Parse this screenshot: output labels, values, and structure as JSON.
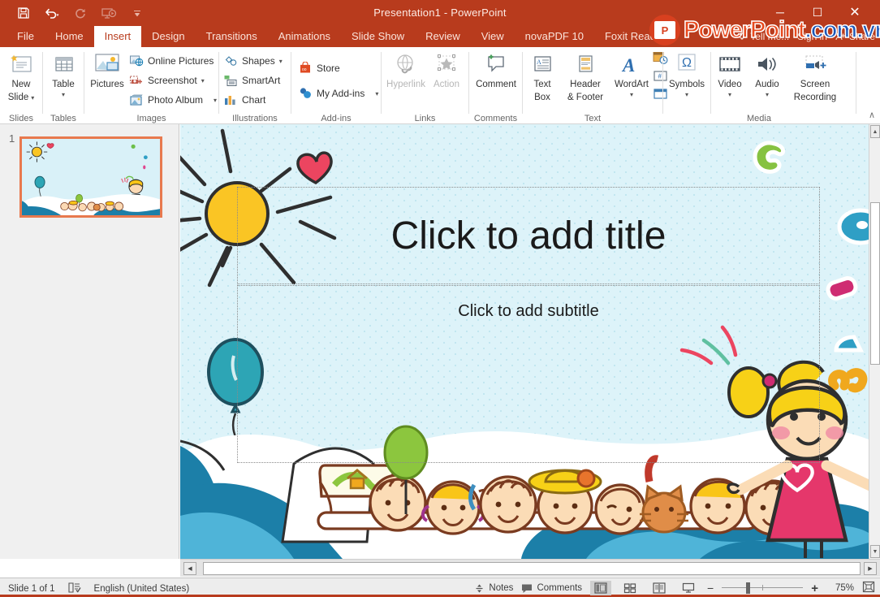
{
  "window": {
    "title": "Presentation1 - PowerPoint",
    "theme_color": "#b83b1d",
    "minimize": "─",
    "maximize": "☐",
    "close": "✕"
  },
  "quick_access": {
    "items": [
      {
        "name": "save-icon",
        "label": "Save"
      },
      {
        "name": "undo-icon",
        "label": "Undo"
      },
      {
        "name": "redo-icon",
        "label": "Redo"
      },
      {
        "name": "start-from-beginning-icon",
        "label": "Start From Beginning"
      },
      {
        "name": "customize-quick-access-toolbar-icon",
        "label": "Customize Quick Access Toolbar"
      }
    ]
  },
  "tabs": [
    {
      "label": "File",
      "active": false
    },
    {
      "label": "Home",
      "active": false
    },
    {
      "label": "Insert",
      "active": true
    },
    {
      "label": "Design",
      "active": false
    },
    {
      "label": "Transitions",
      "active": false
    },
    {
      "label": "Animations",
      "active": false
    },
    {
      "label": "Slide Show",
      "active": false
    },
    {
      "label": "Review",
      "active": false
    },
    {
      "label": "View",
      "active": false
    },
    {
      "label": "novaPDF 10",
      "active": false
    },
    {
      "label": "Foxit Reader",
      "active": false
    }
  ],
  "tab_right": {
    "tell_me": "Tell me...",
    "sign_in": "Sign in",
    "share": "Share"
  },
  "watermark": {
    "badge": "P",
    "part1": "PowerPoint",
    "part2": ".com",
    "part3": ".vn",
    "color1": "#e8491d",
    "color2": "#1b57b8"
  },
  "ribbon": {
    "collapse_label": "∧",
    "groups": [
      {
        "name": "slides",
        "label": "Slides",
        "buttons": [
          {
            "name": "new-slide-button",
            "line1": "New",
            "line2": "Slide",
            "dropdown": true
          }
        ]
      },
      {
        "name": "tables",
        "label": "Tables",
        "buttons": [
          {
            "name": "table-button",
            "line1": "Table",
            "line2": "",
            "dropdown": true
          }
        ]
      },
      {
        "name": "images",
        "label": "Images",
        "buttons": [
          {
            "name": "pictures-button",
            "line1": "Pictures",
            "line2": "",
            "dropdown": false
          }
        ],
        "small_buttons": [
          {
            "name": "online-pictures-button",
            "label": "Online Pictures",
            "dropdown": false
          },
          {
            "name": "screenshot-button",
            "label": "Screenshot",
            "dropdown": true
          },
          {
            "name": "photo-album-button",
            "label": "Photo Album",
            "dropdown": true
          }
        ]
      },
      {
        "name": "illustrations",
        "label": "Illustrations",
        "small_buttons": [
          {
            "name": "shapes-button",
            "label": "Shapes",
            "dropdown": true
          },
          {
            "name": "smartart-button",
            "label": "SmartArt",
            "dropdown": false
          },
          {
            "name": "chart-button",
            "label": "Chart",
            "dropdown": false
          }
        ]
      },
      {
        "name": "add-ins",
        "label": "Add-ins",
        "small_buttons": [
          {
            "name": "store-button",
            "label": "Store",
            "dropdown": false
          },
          {
            "name": "my-add-ins-button",
            "label": "My Add-ins",
            "dropdown": true
          }
        ]
      },
      {
        "name": "links",
        "label": "Links",
        "buttons": [
          {
            "name": "hyperlink-button",
            "line1": "Hyperlink",
            "line2": "",
            "dropdown": false,
            "disabled": true
          },
          {
            "name": "action-button",
            "line1": "Action",
            "line2": "",
            "dropdown": false,
            "disabled": true
          }
        ]
      },
      {
        "name": "comments",
        "label": "Comments",
        "buttons": [
          {
            "name": "comment-button",
            "line1": "Comment",
            "line2": "",
            "dropdown": false
          }
        ]
      },
      {
        "name": "text",
        "label": "Text",
        "buttons": [
          {
            "name": "text-box-button",
            "line1": "Text",
            "line2": "Box",
            "dropdown": false
          },
          {
            "name": "header-and-footer-button",
            "line1": "Header",
            "line2": "& Footer",
            "dropdown": false
          },
          {
            "name": "wordart-button",
            "line1": "WordArt",
            "line2": "",
            "dropdown": true
          }
        ],
        "mini_buttons": [
          {
            "name": "date-and-time-button",
            "label": "Date & Time"
          },
          {
            "name": "slide-number-button",
            "label": "Slide Number"
          },
          {
            "name": "object-button",
            "label": "Object"
          }
        ]
      },
      {
        "name": "symbols",
        "label": "",
        "buttons": [
          {
            "name": "symbols-button",
            "line1": "Symbols",
            "line2": "",
            "dropdown": true,
            "glyph": "Ω"
          }
        ]
      },
      {
        "name": "media",
        "label": "Media",
        "buttons": [
          {
            "name": "video-button",
            "line1": "Video",
            "line2": "",
            "dropdown": true
          },
          {
            "name": "audio-button",
            "line1": "Audio",
            "line2": "",
            "dropdown": true
          },
          {
            "name": "screen-recording-button",
            "line1": "Screen",
            "line2": "Recording",
            "dropdown": false
          }
        ]
      }
    ]
  },
  "thumbnails": [
    {
      "number": "1",
      "selected": true
    }
  ],
  "slide": {
    "title_placeholder": "Click to add title",
    "subtitle_placeholder": "Click to add subtitle",
    "background_color": "#d9f1f8",
    "accent_colors": {
      "sun": "#fac524",
      "balloon_teal": "#2da5b5",
      "balloon_green": "#8cc63e",
      "heart_pink": "#ec4560",
      "wave_blue": "#1c7fa8",
      "dress_pink": "#e5376b",
      "hair_yellow": "#f9c518"
    }
  },
  "status_bar": {
    "slide_count": "Slide 1 of 1",
    "spellcheck_icon": "proofing-icon",
    "language": "English (United States)",
    "notes": "Notes",
    "comments": "Comments",
    "views": [
      {
        "name": "normal-view-button",
        "selected": true
      },
      {
        "name": "slide-sorter-view-button",
        "selected": false
      },
      {
        "name": "reading-view-button",
        "selected": false
      },
      {
        "name": "slide-show-button",
        "selected": false
      }
    ],
    "zoom_out": "−",
    "zoom_in": "+",
    "zoom_level": "75%",
    "fit_to_window": "fit-slide-to-window-icon"
  }
}
